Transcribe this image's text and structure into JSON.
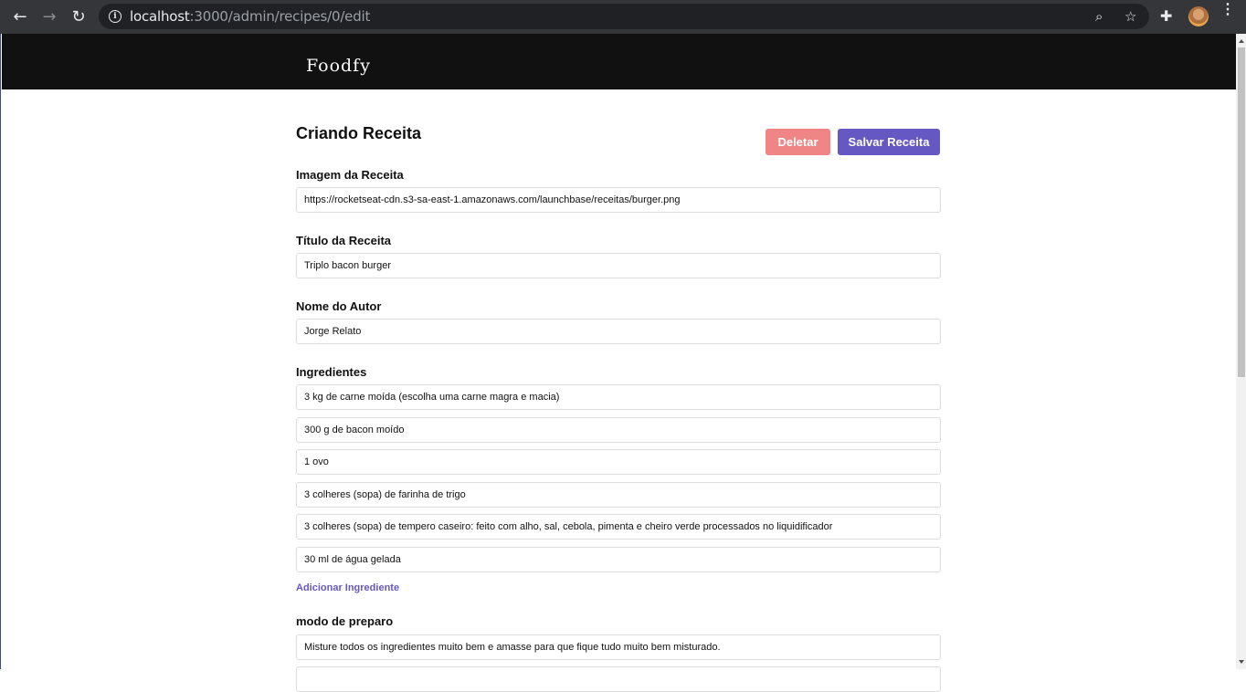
{
  "browser": {
    "url_host": "localhost",
    "url_path": ":3000/admin/recipes/0/edit",
    "back_glyph": "←",
    "forward_glyph": "→",
    "reload_glyph": "↻",
    "zoom_glyph": "⌕",
    "star_glyph": "☆",
    "menu_glyph": "⋮",
    "info_glyph": "i",
    "ext_glyph": "✚"
  },
  "header": {
    "logo": "Foodfy"
  },
  "form": {
    "title": "Criando Receita",
    "delete_label": "Deletar",
    "save_label": "Salvar Receita",
    "image_label": "Imagem da Receita",
    "image_value": "https://rocketseat-cdn.s3-sa-east-1.amazonaws.com/launchbase/receitas/burger.png",
    "title_label": "Título da Receita",
    "title_value": "Triplo bacon burger",
    "author_label": "Nome do Autor",
    "author_value": "Jorge Relato",
    "ingredients_label": "Ingredientes",
    "ingredients": [
      "3 kg de carne moída (escolha uma carne magra e macia)",
      "300 g de bacon moído",
      "1 ovo",
      "3 colheres (sopa) de farinha de trigo",
      "3 colheres (sopa) de tempero caseiro: feito com alho, sal, cebola, pimenta e cheiro verde processados no liquidificador",
      "30 ml de água gelada"
    ],
    "add_ingredient_label": "Adicionar Ingrediente",
    "preparation_label": "modo de preparo",
    "preparation": [
      "Misture todos os ingredientes muito bem e amasse para que fique tudo muito bem misturado.",
      ""
    ]
  }
}
